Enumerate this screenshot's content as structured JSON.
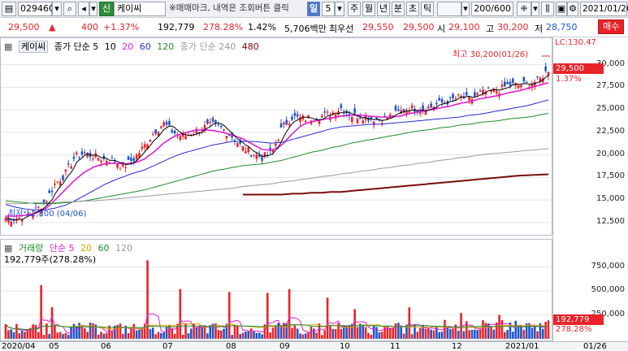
{
  "toolbar": {
    "code": "029460",
    "badge": "신",
    "stock_name": "케이씨",
    "notice": "※매매마크, 내역은 조회버튼 클릭",
    "period_day": "일",
    "period_num": "5",
    "periods": [
      "주",
      "월",
      "년",
      "분",
      "초",
      "틱"
    ],
    "count": "200/600",
    "date": "2021/01/26"
  },
  "info": {
    "price": "29,500",
    "change": "400",
    "pct": "+1.37%",
    "volume": "192,779",
    "vol_ratio": "278.28%",
    "turnover": "1.42%",
    "amount": "5,706백만",
    "best_ask_label": "최우선",
    "best_ask": "29,550",
    "best_bid": "29,500",
    "open_label": "시",
    "open": "29,100",
    "high_label": "고",
    "high": "30,200",
    "low_label": "저",
    "low": "28,750",
    "trade_btn": "매수"
  },
  "price_legend": {
    "name": "케이씨",
    "close_sma": "종가 단순 5",
    "ma": [
      "10",
      "20",
      "60",
      "120"
    ],
    "long_label": "종가 단순 240",
    "long2": "480"
  },
  "vol_legend": {
    "name": "거래량",
    "sma": "단순 5",
    "ma": [
      "20",
      "60",
      "120"
    ],
    "summary": "192,779주(278.28%)"
  },
  "annotations": {
    "lc_label": "LC:130.47",
    "current_price_tag": "29,500",
    "current_pct_tag": "1.37%",
    "high_note": "최고 30,200(01/26)",
    "low_note": "최저 12,800 (04/06)",
    "vol_tag": "192,779",
    "vol_pct_tag": "278.28%"
  },
  "colors": {
    "up": "#e8232a",
    "down": "#1f55c9",
    "ma5": "#000000",
    "ma10": "#000000",
    "ma20": "#e020d0",
    "ma60": "#2a2ad4",
    "ma120": "#1f8c2b",
    "ma240": "#9a9a9a",
    "ma480": "#7a0b0b"
  },
  "chart_data": {
    "type": "candlestick",
    "y_ticks": [
      "30,000",
      "27,500",
      "25,000",
      "22,500",
      "20,000",
      "17,500",
      "15,000",
      "12,500"
    ],
    "y_values": [
      30000,
      27500,
      25000,
      22500,
      20000,
      17500,
      15000,
      12500
    ],
    "ylim": [
      11500,
      31500
    ],
    "vol_ticks": [
      "750,000",
      "500,000",
      "250,000"
    ],
    "vol_values": [
      750000,
      500000,
      250000
    ],
    "vol_lim": [
      0,
      900000
    ],
    "x_labels": [
      "2020/04",
      "05",
      "06",
      "07",
      "08",
      "09",
      "10",
      "11",
      "12",
      "2021/01",
      "01/26"
    ],
    "close_path": [
      13000,
      12900,
      13300,
      13800,
      14800,
      16800,
      17800,
      19800,
      20200,
      19800,
      19500,
      19400,
      18700,
      19600,
      20900,
      22500,
      23500,
      22500,
      22000,
      22500,
      23000,
      23300,
      22900,
      22000,
      20800,
      20200,
      19700,
      20300,
      23000,
      24200,
      24000,
      24100,
      24300,
      24600,
      25200,
      24400,
      24300,
      24100,
      23900,
      24300,
      24800,
      25200,
      25100,
      25300,
      25700,
      26000,
      26400,
      26100,
      26800,
      27000,
      27200,
      27800,
      27700,
      27900,
      28200,
      29500
    ],
    "ma_paths": {
      "ma20": [
        13200,
        13200,
        13300,
        13500,
        14000,
        15000,
        16100,
        17200,
        18100,
        18700,
        19000,
        19100,
        19000,
        19100,
        19500,
        20300,
        21300,
        22000,
        22400,
        22700,
        22800,
        22700,
        22500,
        22200,
        21800,
        21200,
        20600,
        20500,
        21100,
        22300,
        23300,
        23700,
        23900,
        24100,
        24300,
        24400,
        24400,
        24300,
        24200,
        24200,
        24300,
        24600,
        24800,
        25000,
        25200,
        25400,
        25700,
        25900,
        26200,
        26400,
        26600,
        26900,
        27100,
        27400,
        27700,
        28000
      ],
      "ma60": [
        14500,
        14200,
        14000,
        13900,
        13900,
        14100,
        14400,
        14900,
        15500,
        16100,
        16700,
        17200,
        17600,
        18000,
        18300,
        18800,
        19300,
        19800,
        20200,
        20500,
        20800,
        21100,
        21300,
        21500,
        21500,
        21500,
        21400,
        21300,
        21400,
        21700,
        22000,
        22300,
        22600,
        22900,
        23100,
        23200,
        23300,
        23400,
        23400,
        23500,
        23600,
        23700,
        23800,
        23900,
        24000,
        24100,
        24200,
        24400,
        24500,
        24700,
        24900,
        25100,
        25300,
        25500,
        25800,
        26100
      ],
      "ma120": [
        14900,
        14800,
        14700,
        14600,
        14600,
        14600,
        14700,
        14800,
        14900,
        15100,
        15300,
        15500,
        15700,
        15900,
        16100,
        16400,
        16700,
        17000,
        17300,
        17600,
        17900,
        18200,
        18400,
        18600,
        18800,
        18900,
        19000,
        19200,
        19400,
        19700,
        20000,
        20300,
        20500,
        20800,
        21000,
        21300,
        21500,
        21700,
        21900,
        22100,
        22300,
        22500,
        22700,
        22800,
        23000,
        23100,
        23300,
        23400,
        23600,
        23700,
        23800,
        24000,
        24100,
        24200,
        24400,
        24600
      ],
      "ma240": [
        14600,
        14600,
        14600,
        14700,
        14700,
        14700,
        14800,
        14800,
        14900,
        14900,
        15000,
        15100,
        15200,
        15300,
        15400,
        15500,
        15600,
        15700,
        15800,
        15900,
        16000,
        16100,
        16200,
        16300,
        16500,
        16600,
        16700,
        16800,
        17000,
        17100,
        17300,
        17400,
        17600,
        17700,
        17900,
        18000,
        18200,
        18300,
        18500,
        18600,
        18800,
        18900,
        19100,
        19200,
        19400,
        19500,
        19700,
        19800,
        20000,
        20100,
        20200,
        20300,
        20400,
        20500,
        20600,
        20700
      ],
      "ma480": [
        null,
        null,
        null,
        null,
        null,
        null,
        null,
        null,
        null,
        null,
        null,
        null,
        null,
        null,
        null,
        null,
        null,
        null,
        null,
        null,
        null,
        null,
        null,
        null,
        15600,
        15600,
        15600,
        15600,
        15600,
        15700,
        15700,
        15800,
        15800,
        15900,
        15900,
        16000,
        16100,
        16200,
        16300,
        16400,
        16500,
        16600,
        16700,
        16800,
        16900,
        17000,
        17100,
        17200,
        17300,
        17400,
        17500,
        17600,
        17700,
        17750,
        17800,
        17850
      ]
    },
    "volume_spikes": [
      {
        "i": 13,
        "v": 560000,
        "up": true
      },
      {
        "i": 17,
        "v": 330000,
        "up": true
      },
      {
        "i": 52,
        "v": 820000,
        "up": true
      },
      {
        "i": 64,
        "v": 520000,
        "up": true
      },
      {
        "i": 82,
        "v": 490000,
        "up": true
      },
      {
        "i": 96,
        "v": 480000,
        "up": true
      },
      {
        "i": 104,
        "v": 520000,
        "up": true
      },
      {
        "i": 118,
        "v": 430000,
        "up": true
      },
      {
        "i": 128,
        "v": 310000,
        "up": true
      },
      {
        "i": 148,
        "v": 330000,
        "up": true
      },
      {
        "i": 167,
        "v": 270000,
        "up": true
      },
      {
        "i": 181,
        "v": 250000,
        "up": true
      },
      {
        "i": 199,
        "v": 192779,
        "up": true
      }
    ]
  }
}
